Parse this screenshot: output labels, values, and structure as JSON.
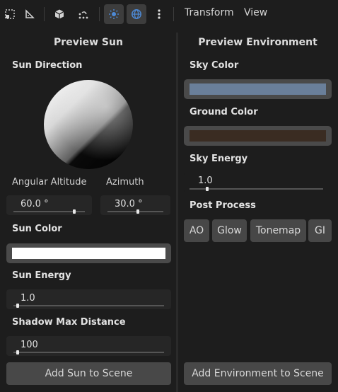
{
  "toolbar": {
    "menus": [
      "Transform",
      "View"
    ],
    "icons": [
      "select-region-icon",
      "ruler-icon",
      "cube-icon",
      "snap-icon",
      "sun-toggle-icon",
      "environment-toggle-icon",
      "kebab-menu-icon"
    ]
  },
  "left": {
    "title": "Preview Sun",
    "sun_direction_label": "Sun Direction",
    "angular_altitude_label": "Angular Altitude",
    "azimuth_label": "Azimuth",
    "angular_altitude_value": "60.0 °",
    "azimuth_value": "30.0 °",
    "angular_altitude_level": 0.85,
    "azimuth_level": 0.55,
    "sun_color_label": "Sun Color",
    "sun_color": "#ffffff",
    "sun_energy_label": "Sun Energy",
    "sun_energy_value": "1.0",
    "sun_energy_level": 0.03,
    "shadow_label": "Shadow Max Distance",
    "shadow_value": "100",
    "shadow_level": 0.03,
    "add_button": "Add Sun to Scene"
  },
  "right": {
    "title": "Preview Environment",
    "sky_color_label": "Sky Color",
    "sky_color": "#6a7f9a",
    "ground_color_label": "Ground Color",
    "ground_color": "#3a2c22",
    "sky_energy_label": "Sky Energy",
    "sky_energy_value": "1.0",
    "sky_energy_level": 0.13,
    "post_process_label": "Post Process",
    "post_process": [
      "AO",
      "Glow",
      "Tonemap",
      "GI"
    ],
    "add_button": "Add Environment to Scene"
  },
  "colors": {
    "accent": "#4d8ad6"
  }
}
